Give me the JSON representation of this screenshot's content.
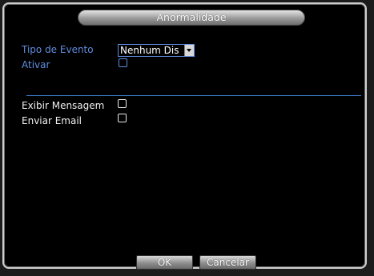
{
  "dialog": {
    "title": "Anormalidade"
  },
  "form": {
    "event_type_label": "Tipo de Evento",
    "event_type_value": "Nenhum Dis",
    "enable_label": "Ativar",
    "enable_checked": false,
    "show_message_label": "Exibir Mensagem",
    "show_message_checked": false,
    "send_email_label": "Enviar Email",
    "send_email_checked": false
  },
  "buttons": {
    "ok_label": "OK",
    "cancel_label": "Cancelar"
  },
  "colors": {
    "accent_label": "#5f8de0",
    "separator": "#3a78c8",
    "background": "#000000"
  },
  "icons": {
    "dropdown": "chevron-down-icon"
  }
}
